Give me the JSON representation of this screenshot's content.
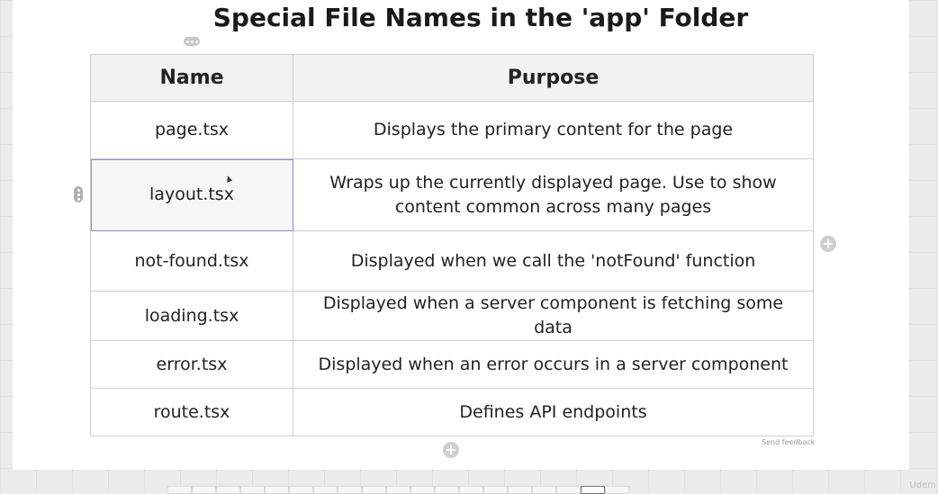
{
  "title": "Special File Names in the 'app' Folder",
  "table": {
    "headers": [
      "Name",
      "Purpose"
    ],
    "rows": [
      {
        "name": "page.tsx",
        "purpose": "Displays the primary content for the page"
      },
      {
        "name": "layout.tsx",
        "purpose": "Wraps up the currently displayed page. Use to show content common across many pages"
      },
      {
        "name": "not-found.tsx",
        "purpose": "Displayed when we call the 'notFound' function"
      },
      {
        "name": "loading.tsx",
        "purpose": "Displayed when a server component is fetching some data"
      },
      {
        "name": "error.tsx",
        "purpose": "Displayed when an error occurs in a server component"
      },
      {
        "name": "route.tsx",
        "purpose": "Defines API endpoints"
      }
    ]
  },
  "feedback_link": "Send feedback",
  "icons": {
    "row_handle": "vertical-dots-icon",
    "column_handle": "horizontal-dots-icon",
    "add": "plus-icon",
    "cursor": "mouse-cursor-icon"
  },
  "watermark": "Udem",
  "page_strip": [
    "",
    "",
    "",
    "",
    "",
    "",
    "",
    "",
    "",
    "",
    "",
    "",
    "",
    "",
    "",
    "",
    "",
    "",
    ""
  ],
  "colors": {
    "selection_outline": "#8a8ad6",
    "header_bg": "#f2f2f2",
    "border": "#cfcfcf"
  }
}
